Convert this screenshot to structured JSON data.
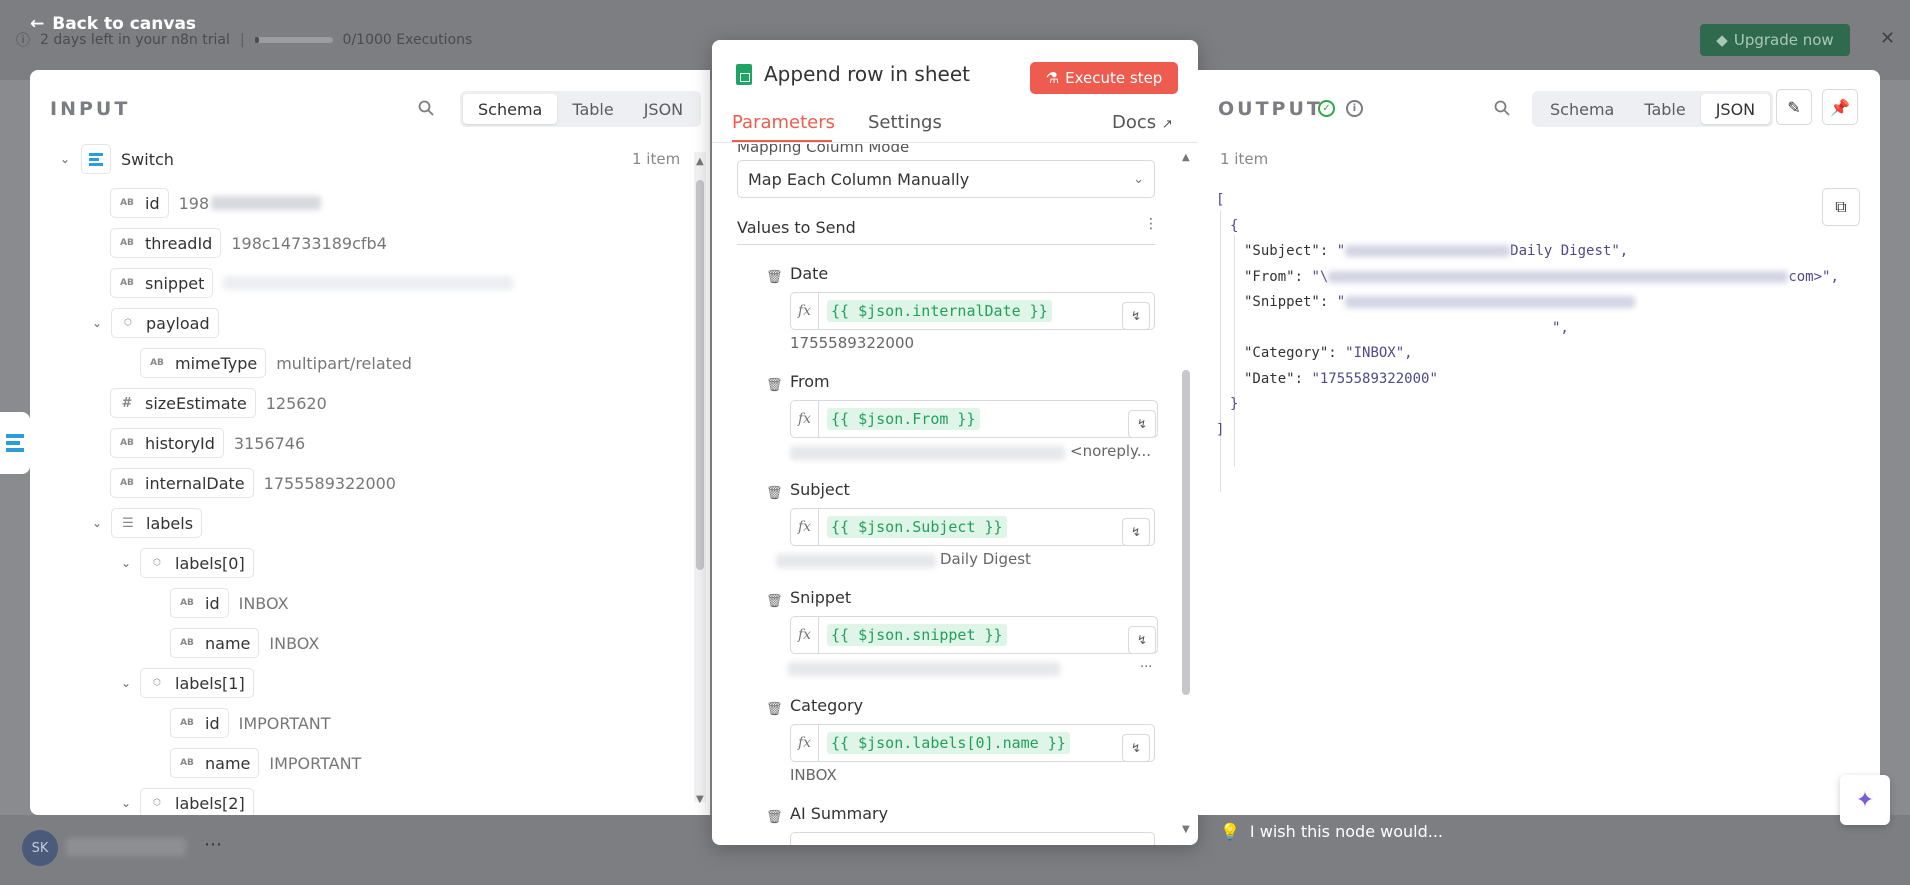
{
  "background": {
    "trial_text": "2 days left in your n8n trial",
    "executions": "0/1000 Executions",
    "upgrade_label": "Upgrade now",
    "back_label": "Back to canvas",
    "avatar_initials": "SK"
  },
  "input": {
    "title": "INPUT",
    "tabs": [
      "Schema",
      "Table",
      "JSON"
    ],
    "active_tab": "Schema",
    "node_name": "Switch",
    "item_count": "1 item",
    "fields": [
      {
        "name": "id",
        "type": "AB",
        "value": "198"
      },
      {
        "name": "threadId",
        "type": "AB",
        "value": "198c14733189cfb4"
      },
      {
        "name": "snippet",
        "type": "AB",
        "value": ""
      },
      {
        "name": "payload",
        "type": "obj",
        "value": ""
      },
      {
        "name": "mimeType",
        "type": "AB",
        "value": "multipart/related"
      },
      {
        "name": "sizeEstimate",
        "type": "#",
        "value": "125620"
      },
      {
        "name": "historyId",
        "type": "AB",
        "value": "3156746"
      },
      {
        "name": "internalDate",
        "type": "AB",
        "value": "1755589322000"
      },
      {
        "name": "labels",
        "type": "list",
        "value": ""
      },
      {
        "name": "labels[0]",
        "type": "obj",
        "value": ""
      },
      {
        "name": "id",
        "type": "AB",
        "value": "INBOX"
      },
      {
        "name": "name",
        "type": "AB",
        "value": "INBOX"
      },
      {
        "name": "labels[1]",
        "type": "obj",
        "value": ""
      },
      {
        "name": "id",
        "type": "AB",
        "value": "IMPORTANT"
      },
      {
        "name": "name",
        "type": "AB",
        "value": "IMPORTANT"
      },
      {
        "name": "labels[2]",
        "type": "obj",
        "value": ""
      }
    ]
  },
  "node": {
    "title": "Append row in sheet",
    "execute_label": "Execute step",
    "tabs": {
      "parameters": "Parameters",
      "settings": "Settings",
      "docs": "Docs"
    },
    "mapping_label": "Mapping Column Mode",
    "mapping_value": "Map Each Column Manually",
    "values_to_send": "Values to Send",
    "columns": [
      {
        "label": "Date",
        "expr": "{{ $json.internalDate }}",
        "preview": "1755589322000"
      },
      {
        "label": "From",
        "expr": "{{ $json.From }}",
        "preview": "<noreply..."
      },
      {
        "label": "Subject",
        "expr": "{{ $json.Subject }}",
        "preview": "Daily Digest"
      },
      {
        "label": "Snippet",
        "expr": "{{ $json.snippet }}",
        "preview": "..."
      },
      {
        "label": "Category",
        "expr": "{{ $json.labels[0].name }}",
        "preview": "INBOX"
      },
      {
        "label": "AI Summary",
        "expr": "",
        "preview": ""
      }
    ],
    "fx_label": "fx"
  },
  "output": {
    "title": "OUTPUT",
    "tabs": [
      "Schema",
      "Table",
      "JSON"
    ],
    "active_tab": "JSON",
    "item_count": "1 item",
    "json": {
      "open_bracket": "[",
      "open_brace": "{",
      "subject_key": "\"Subject\":",
      "subject_val": "Daily Digest\",",
      "from_key": "\"From\":",
      "from_val": "com>\",",
      "snippet_key": "\"Snippet\":",
      "snippet_end": "\",",
      "category_key": "\"Category\":",
      "category_val": "\"INBOX\",",
      "date_key": "\"Date\":",
      "date_val": "\"1755589322000\"",
      "close_brace": "}",
      "close_bracket": "]"
    },
    "wish_label": "I wish this node would..."
  },
  "colors": {
    "accent": "#ee5b4f",
    "success": "#2ba84a",
    "code_green": "#23a05c"
  }
}
